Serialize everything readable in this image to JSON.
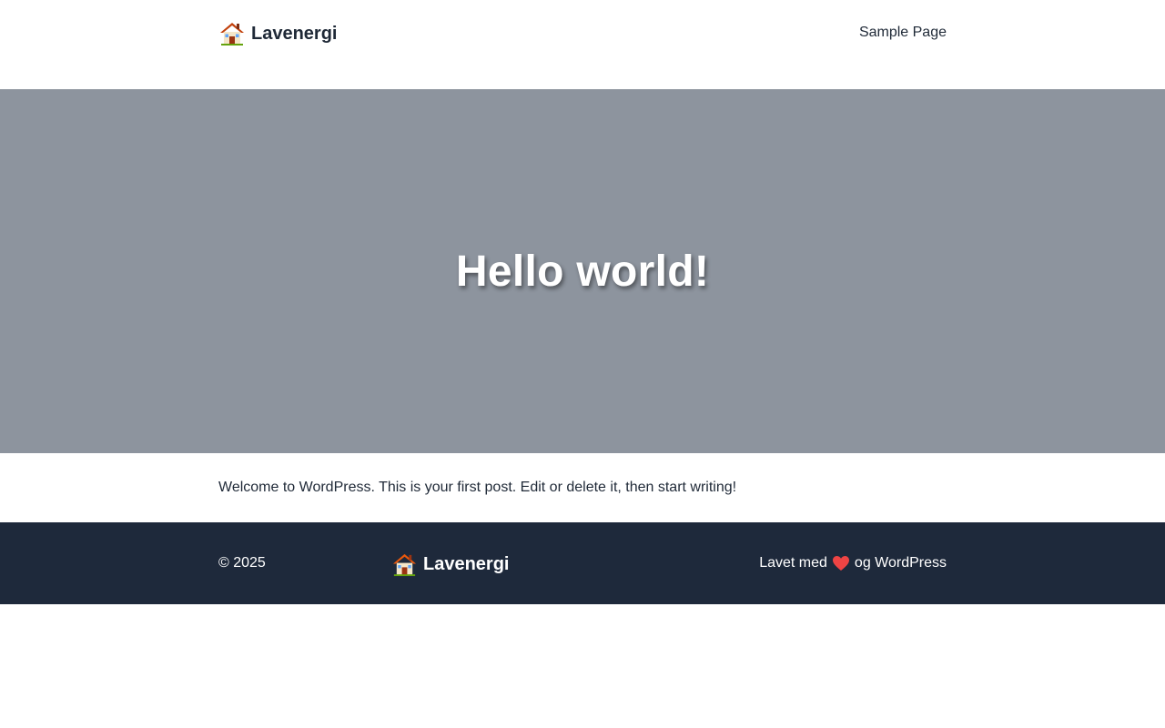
{
  "header": {
    "brand_icon": "house-icon",
    "brand_name": "Lavenergi",
    "nav_item": "Sample Page"
  },
  "hero": {
    "title": "Hello world!",
    "background": "#8d949e"
  },
  "content": {
    "text": "Welcome to WordPress. This is your first post. Edit or delete it, then start writing!"
  },
  "footer": {
    "copyright": "© 2025",
    "brand_icon": "house-icon",
    "brand_name": "Lavenergi",
    "credit_prefix": "Lavet med",
    "credit_icon": "heart-icon",
    "credit_suffix": "og WordPress",
    "background": "#1e293b"
  }
}
